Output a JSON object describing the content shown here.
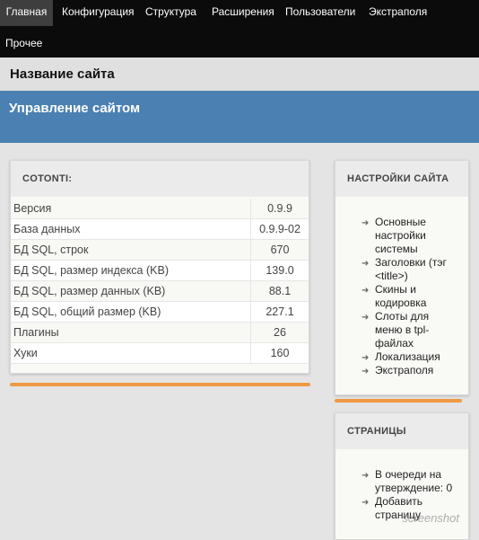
{
  "nav": {
    "items": [
      {
        "label": "Главная",
        "active": true
      },
      {
        "label": "Конфигурация"
      },
      {
        "label": "Структура"
      },
      {
        "label": "Расширения"
      },
      {
        "label": "Пользователи"
      },
      {
        "label": "Экстраполя"
      },
      {
        "label": "Прочее"
      }
    ]
  },
  "site": {
    "title": "Название сайта"
  },
  "admin": {
    "title": "Управление сайтом"
  },
  "stats_card": {
    "title": "COTONTI:",
    "rows": [
      {
        "label": "Версия",
        "value": "0.9.9"
      },
      {
        "label": "База данных",
        "value": "0.9.9-02"
      },
      {
        "label": "БД SQL, строк",
        "value": "670"
      },
      {
        "label": "БД SQL, размер индекса (KB)",
        "value": "139.0"
      },
      {
        "label": "БД SQL, размер данных (KB)",
        "value": "88.1"
      },
      {
        "label": "БД SQL, общий размер (KB)",
        "value": "227.1"
      },
      {
        "label": "Плагины",
        "value": "26"
      },
      {
        "label": "Хуки",
        "value": "160"
      }
    ]
  },
  "settings_card": {
    "title": "НАСТРОЙКИ САЙТА",
    "links": [
      "Основные настройки системы",
      "Заголовки (тэг <title>)",
      "Скины и кодировка",
      "Слоты для меню в tpl-файлах",
      "Локализация",
      "Экстраполя"
    ]
  },
  "pages_card": {
    "title": "СТРАНИЦЫ",
    "links": [
      "В очереди на утверждение: 0",
      "Добавить страницу"
    ]
  },
  "icons": {
    "arrow": "arrow-right-icon"
  },
  "colors": {
    "topnav": "#0b0b0b",
    "band": "#4a80b2",
    "accent": "#ee9944"
  },
  "watermark": {
    "text": "screenshot"
  }
}
